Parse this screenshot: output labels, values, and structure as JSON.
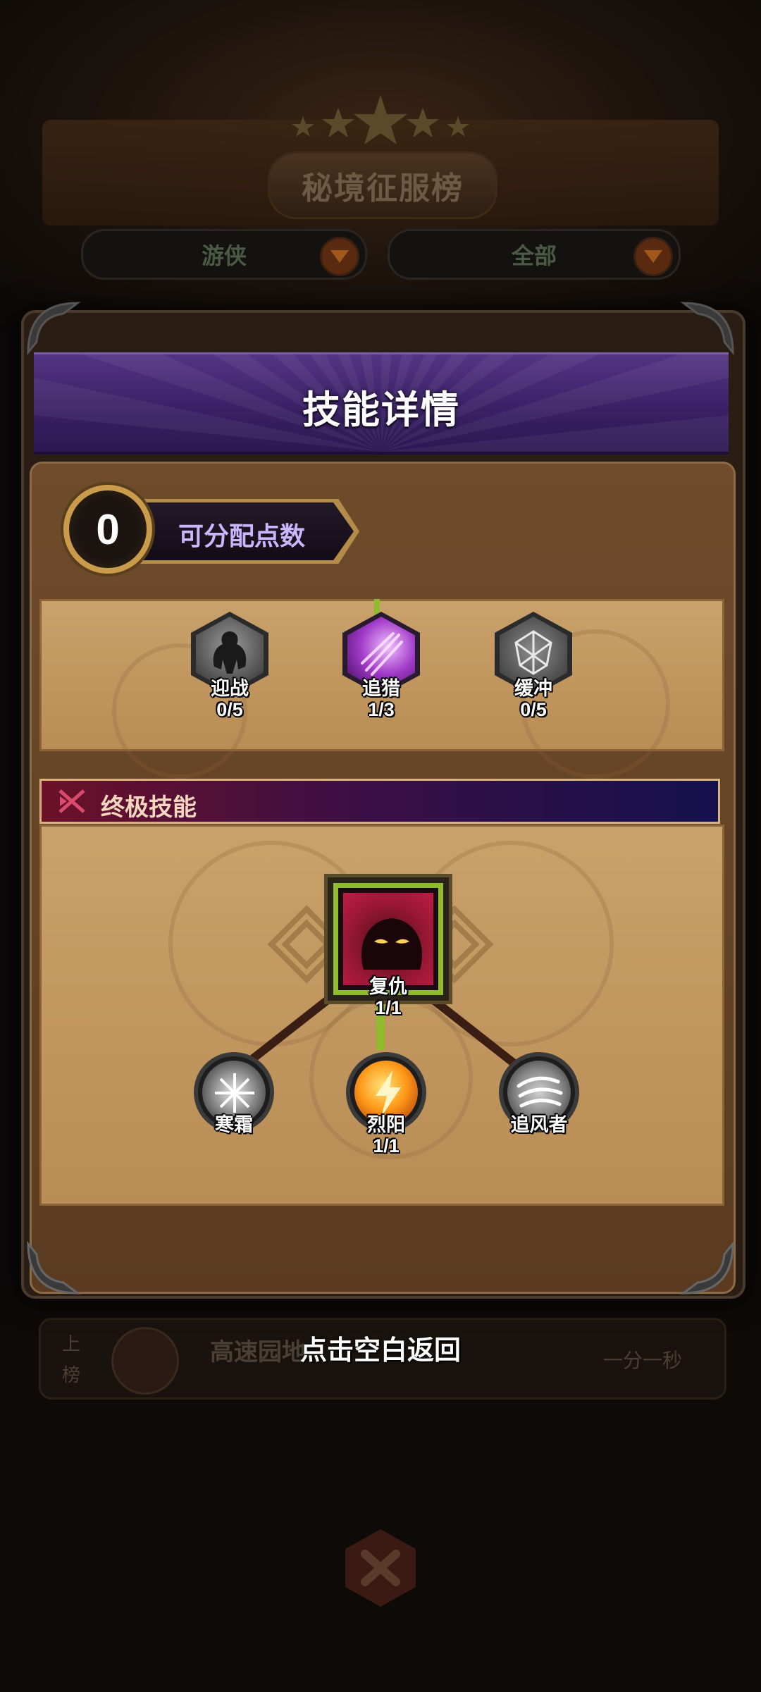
{
  "background": {
    "leaderboard_title": "秘境征服榜",
    "filter_class": "游侠",
    "filter_scope": "全部",
    "row": {
      "rank_label": "上榜",
      "player_name": "高速园地",
      "time_text": "一分一秒"
    }
  },
  "dialog": {
    "title": "技能详情",
    "points": {
      "value": "0",
      "label": "可分配点数"
    },
    "tier_skills": [
      {
        "name": "迎战",
        "level": "0/5",
        "icon": "warrior-silhouette-icon"
      },
      {
        "name": "追猎",
        "level": "1/3",
        "icon": "purple-strike-icon"
      },
      {
        "name": "缓冲",
        "level": "0/5",
        "icon": "crystal-net-icon"
      }
    ],
    "ultimate_section": {
      "label": "终极技能",
      "root": {
        "name": "复仇",
        "level": "1/1",
        "icon": "shadow-demon-icon"
      },
      "branches": [
        {
          "name": "寒霜",
          "level": "",
          "icon": "frost-burst-icon"
        },
        {
          "name": "烈阳",
          "level": "1/1",
          "icon": "fire-sun-icon"
        },
        {
          "name": "追风者",
          "level": "",
          "icon": "wind-swirl-icon"
        }
      ]
    },
    "dismiss_hint": "点击空白返回"
  },
  "colors": {
    "header_purple": "#3a2166",
    "panel_parchment": "#c9a16a",
    "active_green": "#8ebc2c",
    "gold_border": "#c99b4a"
  }
}
